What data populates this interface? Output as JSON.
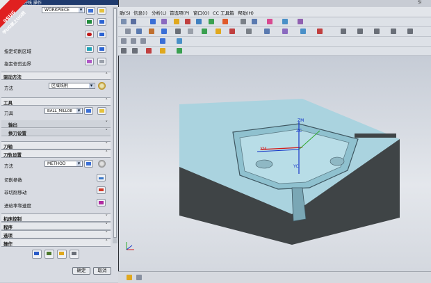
{
  "dialog": {
    "title": "型腔铣 操作",
    "geometry": {
      "workpiece_value": "WORKPIECE",
      "specify_cut_area_label": "指定切削区域",
      "specify_trim_boundary_label": "指定修剪边界"
    },
    "drive_method": {
      "header": "驱动方法",
      "method_label": "方法",
      "method_value": "区域铣削"
    },
    "tool": {
      "header": "工具",
      "tool_label": "刀具",
      "tool_value": "BALL_MILL08",
      "output_label": "输出",
      "tool_change_label": "换刀设置"
    },
    "tool_axis_header": "刀轴",
    "tool_path_settings": {
      "header": "刀轨设置",
      "method_label": "方法",
      "method_value": "METHOD",
      "cut_params_label": "切削参数",
      "non_cut_moves_label": "非切削移动",
      "feeds_speeds_label": "进给率和速度"
    },
    "machine_control_header": "机床控制",
    "program_header": "程序",
    "options_header": "选项",
    "actions_header": "操作",
    "ok_label": "确定",
    "cancel_label": "取消"
  },
  "watermark": {
    "line1": "9SUG",
    "line2": "学UG就上UG网"
  },
  "menubar": {
    "items": [
      "助(S)",
      "信息(I)",
      "分析(L)",
      "首选项(P)",
      "窗口(O)",
      "CC 工具箱",
      "帮助(H)"
    ],
    "logo": "SI"
  },
  "viewport": {
    "zm_label": "ZM",
    "zc_label": "ZC",
    "yc_label": "YC",
    "xm_label": "XM"
  },
  "colors": {
    "dialog_bg": "#d8dbe2",
    "part_top": "#aad3df",
    "part_side": "#3f4446",
    "toolpath": "#d21a1a",
    "axis": "#1436c8"
  }
}
